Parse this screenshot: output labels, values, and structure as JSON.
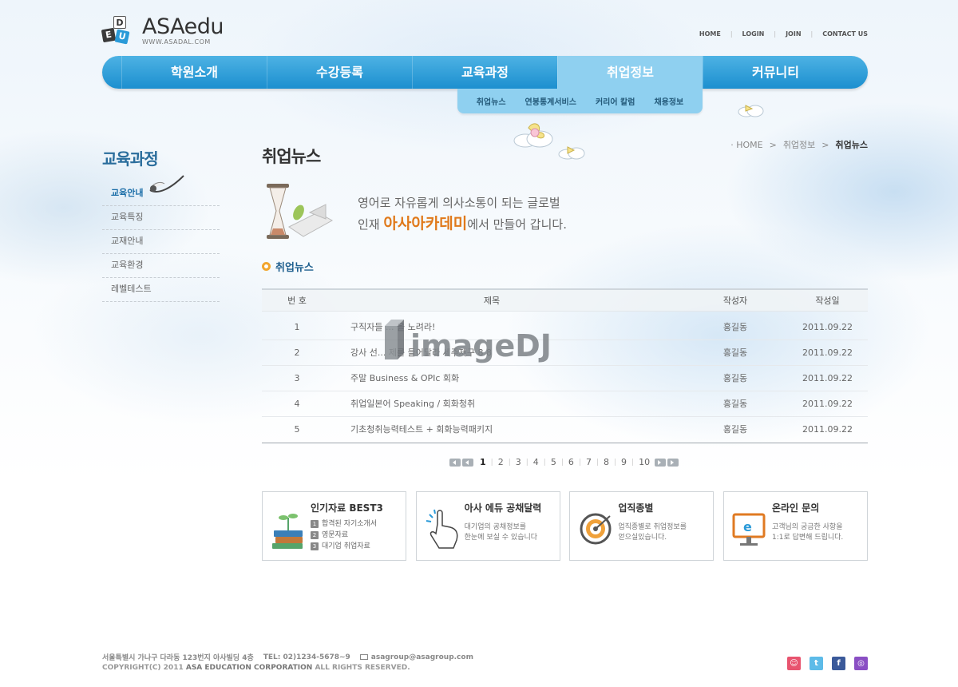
{
  "header": {
    "logo_letters": [
      "D",
      "E",
      "U"
    ],
    "brand": "ASAedu",
    "url": "WWW.ASADAL.COM",
    "top_links": [
      "HOME",
      "LOGIN",
      "JOIN",
      "CONTACT US"
    ]
  },
  "gnb": {
    "items": [
      "학원소개",
      "수강등록",
      "교육과정",
      "취업정보",
      "커뮤니티"
    ],
    "active_index": 3,
    "sub_items": [
      "취업뉴스",
      "연봉통계서비스",
      "커리어 칼럼",
      "채용정보"
    ]
  },
  "sidebar": {
    "title": "교육과정",
    "items": [
      "교육안내",
      "교육특징",
      "교재안내",
      "교육환경",
      "레벨테스트"
    ],
    "active_index": 0
  },
  "content": {
    "title": "취업뉴스",
    "breadcrumb": [
      "· HOME",
      "취업정보",
      "취업뉴스"
    ],
    "slogan_line1": "영어로 자유롭게 의사소통이 되는 글로벌",
    "slogan_line2_pre": "인재 ",
    "slogan_highlight": "아사아카데미",
    "slogan_line2_post": "에서 만들어 갑니다.",
    "section_title": "취업뉴스"
  },
  "board": {
    "columns": [
      "번 호",
      "제목",
      "작성자",
      "작성일"
    ],
    "rows": [
      {
        "no": "1",
        "title": "구직자들 ... 을 노려라!",
        "writer": "홍길동",
        "date": "2011.09.22"
      },
      {
        "no": "2",
        "title": "강사 선... 제를 들어달라 세주제구 8 8",
        "writer": "홍길동",
        "date": "2011.09.22"
      },
      {
        "no": "3",
        "title": "주말 Business & OPIc 회화",
        "writer": "홍길동",
        "date": "2011.09.22"
      },
      {
        "no": "4",
        "title": "취업일본어 Speaking / 회화청취",
        "writer": "홍길동",
        "date": "2011.09.22"
      },
      {
        "no": "5",
        "title": "기초청취능력테스트 + 회화능력패키지",
        "writer": "홍길동",
        "date": "2011.09.22"
      }
    ]
  },
  "watermark": "imageDJ",
  "pager": {
    "pages": [
      "1",
      "2",
      "3",
      "4",
      "5",
      "6",
      "7",
      "8",
      "9",
      "10"
    ],
    "current": "1"
  },
  "boxes": [
    {
      "title": "인기자료 BEST3",
      "list": [
        {
          "n": "1",
          "text": "합격된 자기소개서"
        },
        {
          "n": "2",
          "text": "영문자료"
        },
        {
          "n": "3",
          "text": "대기업 취업자료"
        }
      ]
    },
    {
      "title": "아사 에듀 공채달력",
      "desc1": "대기업의 공채정보를",
      "desc2": "한눈에 보실 수 있습니다"
    },
    {
      "title": "업직종별",
      "desc1": "업직종별로 취업정보를",
      "desc2": "얻으실있습니다."
    },
    {
      "title": "온라인 문의",
      "desc1": "고객님의 궁금한 사항을",
      "desc2": "1:1로 답변해 드립니다."
    }
  ],
  "footer": {
    "address": "서울특별시 가나구 다라동 123번지 아사빌딩 4층",
    "tel": "TEL: 02)1234-5678~9",
    "email": "asagroup@asagroup.com",
    "copyright_pre": "COPYRIGHT(C) 2011 ",
    "copyright_company": "ASA EDUCATION CORPORATION",
    "copyright_post": " ALL RIGHTS RESERVED.",
    "social": [
      "me2day-icon",
      "twitter-icon",
      "facebook-icon",
      "yozm-icon"
    ]
  },
  "colors": {
    "nav_blue": "#1c8fcf",
    "nav_active": "#8fd0f0",
    "accent_orange": "#e0791a",
    "title_blue": "#2a6d9c"
  }
}
